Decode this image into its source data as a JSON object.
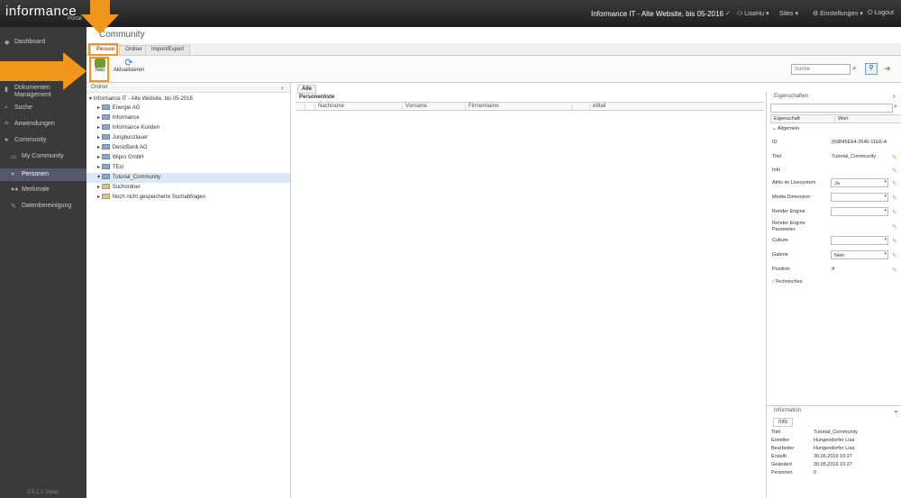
{
  "topbar": {
    "logo": "informance",
    "logo_sub": "Portal",
    "site_title": "Informance IT - Alte Website, bis 05-2016",
    "user": "LisaHu",
    "sites": "Sites",
    "settings": "Einstellungen",
    "logout": "Logout"
  },
  "sidebar": {
    "items": [
      {
        "label": "Dashboard"
      },
      {
        "label": "Dokumenten Management"
      },
      {
        "label": "Suche"
      },
      {
        "label": "Anwendungen"
      },
      {
        "label": "Community"
      },
      {
        "label": "My Community"
      },
      {
        "label": "Personen"
      },
      {
        "label": "Merkmale"
      },
      {
        "label": "Datenbereinigung"
      }
    ],
    "version": "3.5.2.1 Voxel"
  },
  "header": {
    "title": "Community"
  },
  "tabs": [
    {
      "label": "Person"
    },
    {
      "label": "Ordner"
    },
    {
      "label": "Import/Export"
    }
  ],
  "toolbar": {
    "new_label": "Neu",
    "refresh_label": "Aktualisieren",
    "search_placeholder": "Suche"
  },
  "folders": {
    "header": "Ordner",
    "root": "Informance IT - Alte Website, bis 05-2016",
    "items": [
      {
        "label": "Energie AG"
      },
      {
        "label": "Informance"
      },
      {
        "label": "Informance Kunden"
      },
      {
        "label": "Jungbunzlauer"
      },
      {
        "label": "DenizBank AG"
      },
      {
        "label": "Wipro GmbH"
      },
      {
        "label": "TEst"
      },
      {
        "label": "Tutorial_Community"
      },
      {
        "label": "Suchordner"
      },
      {
        "label": "Noch nicht gespeicherte Suchabfragen"
      }
    ]
  },
  "main": {
    "tab": "Alle",
    "list_title": "Personenliste",
    "columns": [
      "Nachname",
      "Vorname",
      "Firmenname",
      "eMail"
    ]
  },
  "properties": {
    "title": "Eigenschaften",
    "col_prop": "Eigenschaft",
    "col_val": "Wert",
    "group_general": "Allgemein",
    "group_technical": "Technisches",
    "rows": [
      {
        "name": "ID",
        "value": "{60B45E64-2640-11E6-A"
      },
      {
        "name": "Titel",
        "value": "Tutorial_Community"
      },
      {
        "name": "Info",
        "value": ""
      },
      {
        "name": "Aktiv im Livesystem",
        "value": "Ja"
      },
      {
        "name": "Media Dimension",
        "value": ""
      },
      {
        "name": "Render Engine",
        "value": ""
      },
      {
        "name": "Render Engine Parameter",
        "value": ""
      },
      {
        "name": "Culture",
        "value": ""
      },
      {
        "name": "Galerie",
        "value": "Nein"
      },
      {
        "name": "Position",
        "value": "4"
      }
    ]
  },
  "information": {
    "title": "Information",
    "tab": "Info",
    "rows": [
      {
        "name": "Titel",
        "value": "Tutorial_Community"
      },
      {
        "name": "Ersteller",
        "value": "Hungendorfer Lisa"
      },
      {
        "name": "Bearbeiter",
        "value": "Hungendorfer Lisa"
      },
      {
        "name": "Erstellt",
        "value": "30.05.2016 10:27"
      },
      {
        "name": "Geändert",
        "value": "30.05.2016 10:27"
      },
      {
        "name": "Personen",
        "value": "0"
      }
    ]
  }
}
